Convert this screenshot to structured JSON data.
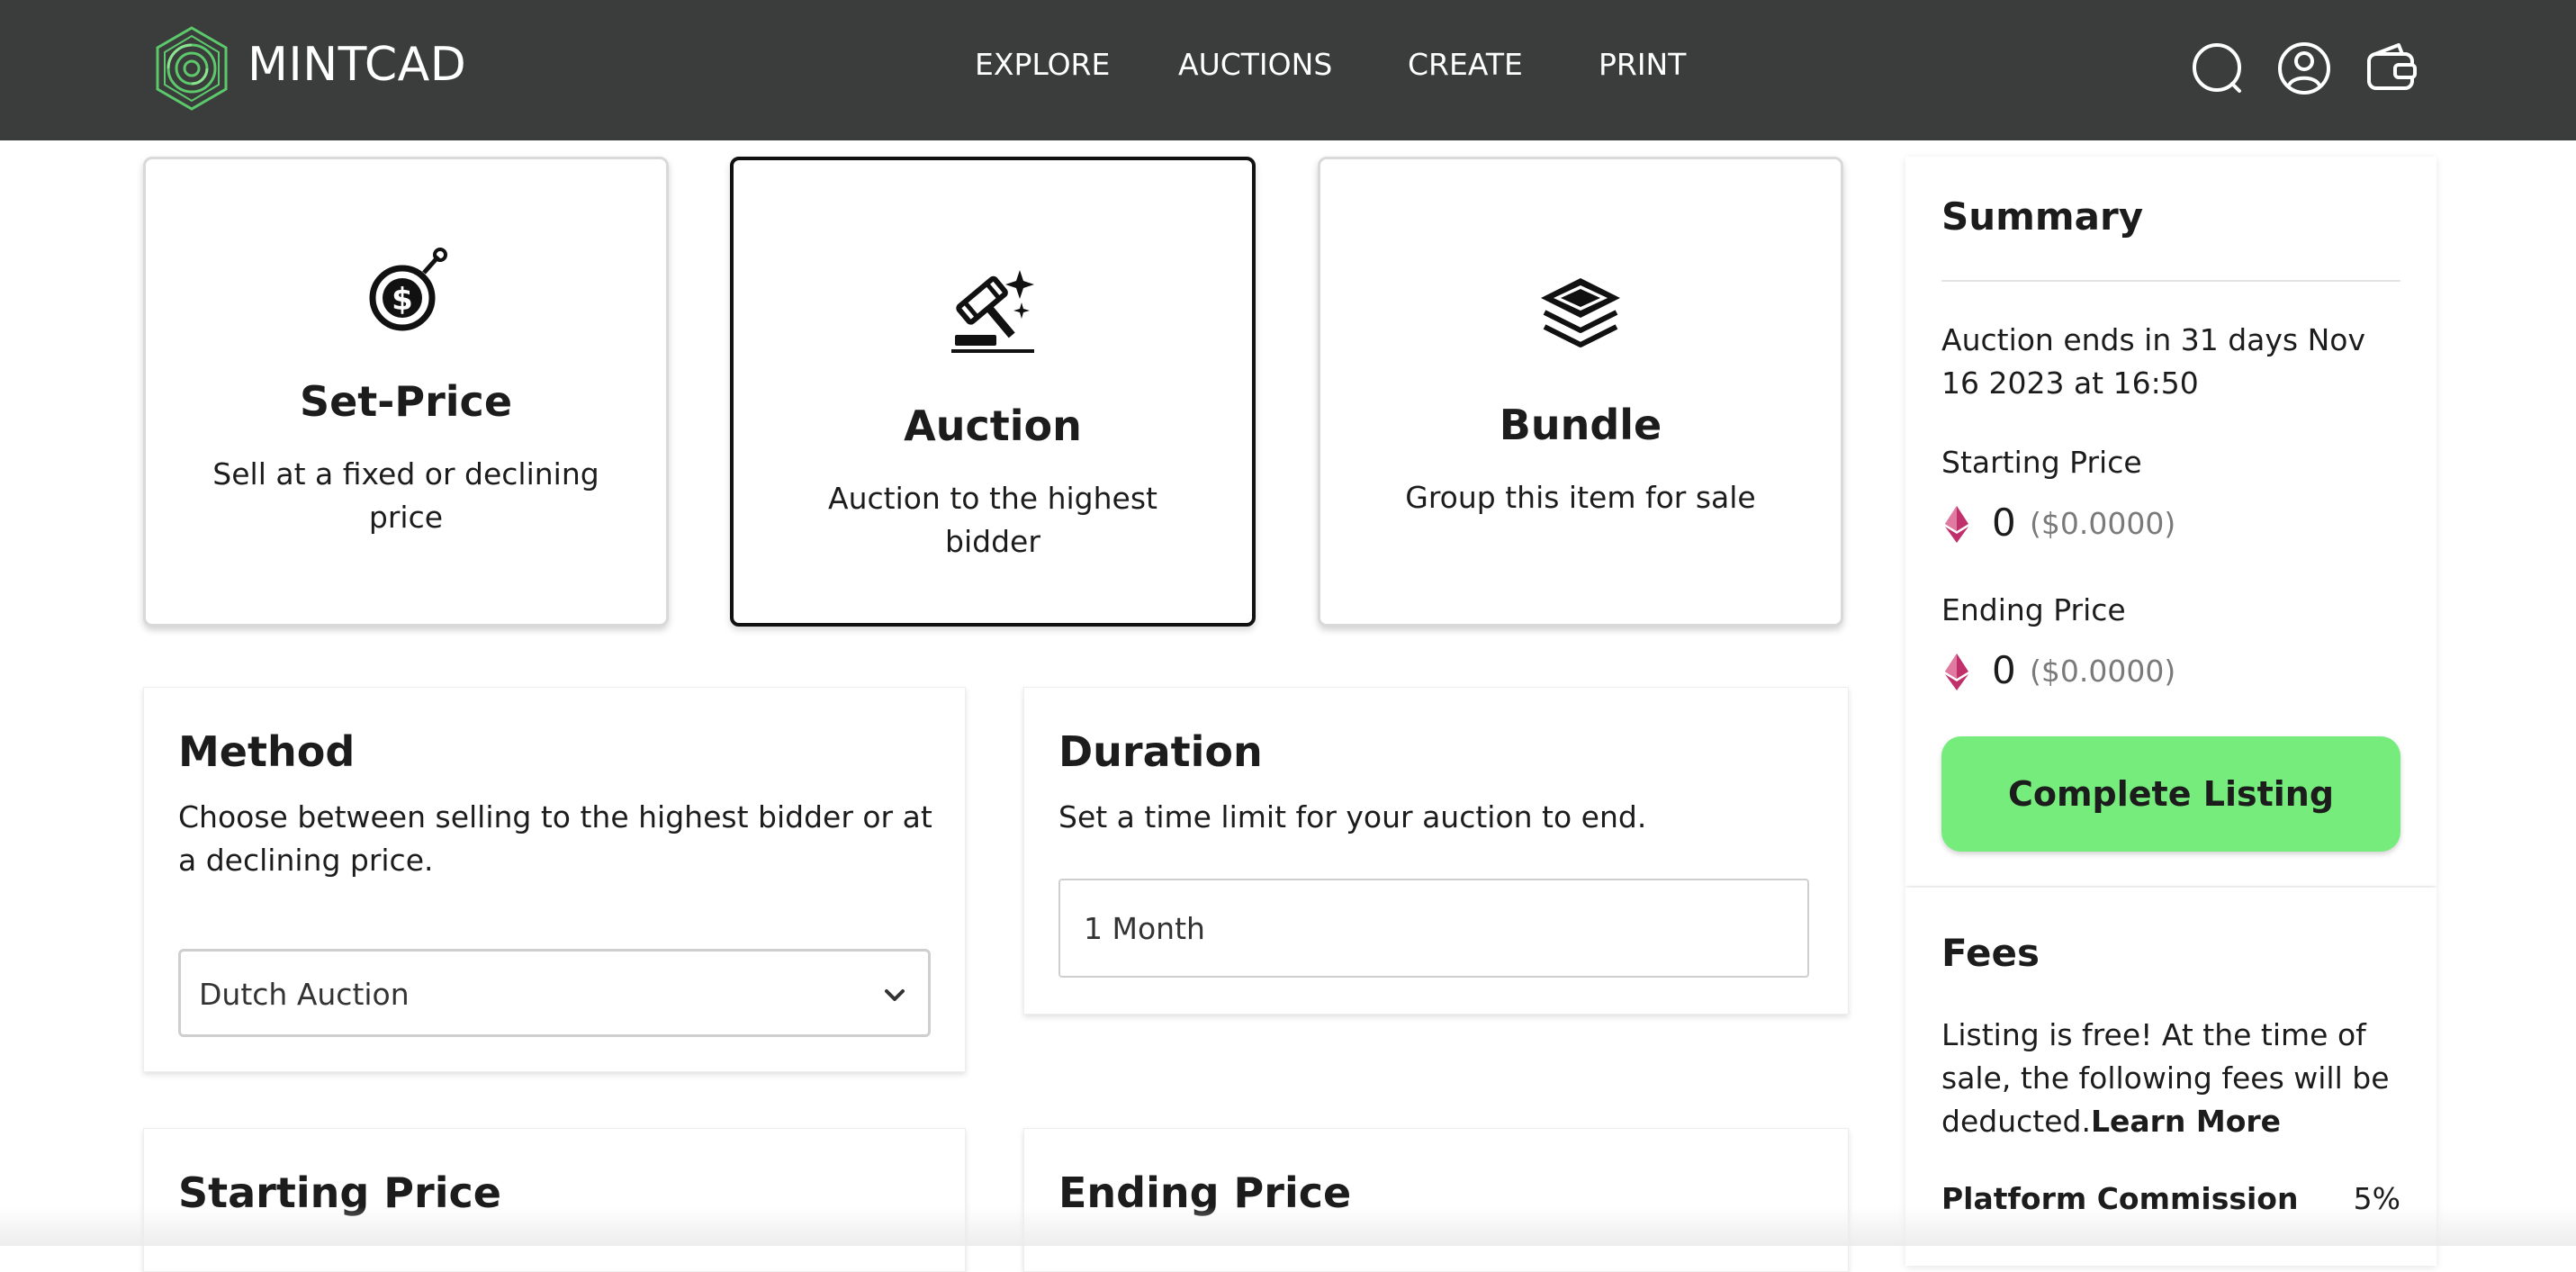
{
  "header": {
    "brand": "MINTCAD",
    "nav": [
      "EXPLORE",
      "AUCTIONS",
      "CREATE",
      "PRINT"
    ],
    "icons": [
      "search-icon",
      "user-icon",
      "wallet-icon"
    ],
    "logo_color": "#5cc96a"
  },
  "listing_types": [
    {
      "title": "Set-Price",
      "desc": "Sell at a fixed or declining price",
      "icon": "price-tag-icon",
      "selected": false
    },
    {
      "title": "Auction",
      "desc": "Auction to the highest bidder",
      "icon": "gavel-icon",
      "selected": true
    },
    {
      "title": "Bundle",
      "desc": "Group this item for sale",
      "icon": "layers-icon",
      "selected": false
    }
  ],
  "method": {
    "title": "Method",
    "desc": "Choose between selling to the highest bidder or at a declining price.",
    "selected": "Dutch Auction"
  },
  "duration": {
    "title": "Duration",
    "desc": "Set a time limit for your auction to end.",
    "value": "1 Month"
  },
  "starting_price_section": {
    "title": "Starting Price"
  },
  "ending_price_section": {
    "title": "Ending Price"
  },
  "summary": {
    "title": "Summary",
    "ends_text": "Auction ends in 31 days Nov 16 2023 at 16:50",
    "starting_label": "Starting Price",
    "starting_value": "0",
    "starting_usd": "($0.0000)",
    "ending_label": "Ending Price",
    "ending_value": "0",
    "ending_usd": "($0.0000)",
    "button": "Complete Listing",
    "button_color": "#76ec7c"
  },
  "fees": {
    "title": "Fees",
    "text": "Listing is free! At the time of sale, the following fees will be deducted.",
    "learn_more": "Learn More",
    "commission_label": "Platform Commission",
    "commission_value": "5%"
  }
}
